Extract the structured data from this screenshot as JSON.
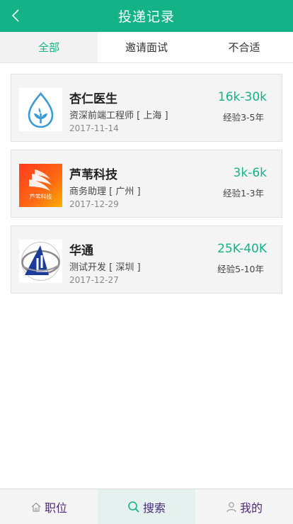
{
  "header": {
    "title": "投递记录"
  },
  "tabs": [
    {
      "label": "全部",
      "active": true
    },
    {
      "label": "邀请面试",
      "active": false
    },
    {
      "label": "不合适",
      "active": false
    }
  ],
  "records": [
    {
      "company": "杏仁医生",
      "position": "资深前端工程师 [ 上海 ]",
      "date": "2017-11-14",
      "salary": "16k-30k",
      "experience": "经验3-5年",
      "logo": "apricot-logo"
    },
    {
      "company": "芦苇科技",
      "position": "商务助理 [ 广州 ]",
      "date": "2017-12-29",
      "salary": "3k-6k",
      "experience": "经验1-3年",
      "logo": "reed-logo",
      "logo_text": "芦苇科技"
    },
    {
      "company": "华通",
      "position": "测试开发 [ 深圳 ]",
      "date": "2017-12-27",
      "salary": "25K-40K",
      "experience": "经验5-10年",
      "logo": "huatong-logo"
    }
  ],
  "bottom_nav": [
    {
      "label": "职位",
      "icon": "home-icon",
      "active": false
    },
    {
      "label": "搜索",
      "icon": "search-icon",
      "active": true
    },
    {
      "label": "我的",
      "icon": "user-icon",
      "active": false
    }
  ],
  "colors": {
    "brand": "#13b287",
    "nav_text": "#4a2a7a"
  }
}
